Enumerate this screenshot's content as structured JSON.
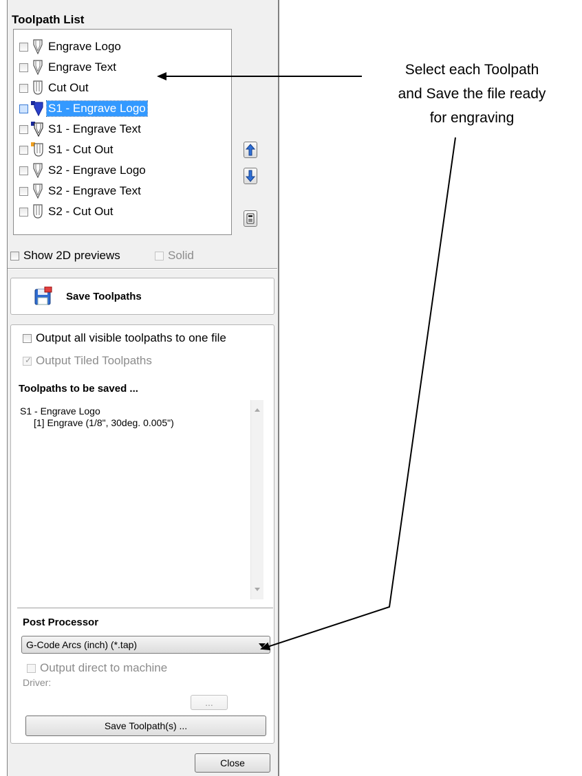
{
  "toolpath_list": {
    "title": "Toolpath List",
    "items": [
      {
        "label": "Engrave Logo",
        "icon": "engrave-tool-icon",
        "selected": false
      },
      {
        "label": "Engrave Text",
        "icon": "engrave-tool-icon",
        "selected": false
      },
      {
        "label": "Cut Out",
        "icon": "cutout-tool-icon",
        "selected": false
      },
      {
        "label": "S1 - Engrave Logo",
        "icon": "engrave-tool-icon",
        "selected": true
      },
      {
        "label": "S1 - Engrave Text",
        "icon": "engrave-tool-icon",
        "selected": false
      },
      {
        "label": "S1 - Cut Out",
        "icon": "cutout-tool-icon",
        "selected": false
      },
      {
        "label": "S2 - Engrave Logo",
        "icon": "engrave-tool-icon",
        "selected": false
      },
      {
        "label": "S2 - Engrave Text",
        "icon": "engrave-tool-icon",
        "selected": false
      },
      {
        "label": "S2 - Cut Out",
        "icon": "cutout-tool-icon",
        "selected": false
      }
    ],
    "show_2d_previews": "Show 2D previews",
    "solid": "Solid"
  },
  "save_toolpaths": {
    "title": "Save Toolpaths",
    "output_all_visible": "Output all visible toolpaths to one file",
    "output_tiled": "Output Tiled Toolpaths",
    "to_be_saved_title": "Toolpaths to be saved ...",
    "to_be_saved_line1": "S1 - Engrave Logo",
    "to_be_saved_line2": "[1] Engrave (1/8\", 30deg. 0.005\")",
    "post_processor_title": "Post Processor",
    "post_processor_value": "G-Code Arcs (inch) (*.tap)",
    "output_direct": "Output direct to machine",
    "driver_label": "Driver:",
    "browse_label": "...",
    "save_button": "Save Toolpath(s) ...",
    "close_button": "Close"
  },
  "annotation": {
    "line1": "Select each Toolpath",
    "line2": "and Save the file ready",
    "line3": "for engraving"
  },
  "colors": {
    "selection": "#3399ff",
    "panel": "#f0f0f0",
    "up_down_arrows": "#1e5ab4"
  }
}
